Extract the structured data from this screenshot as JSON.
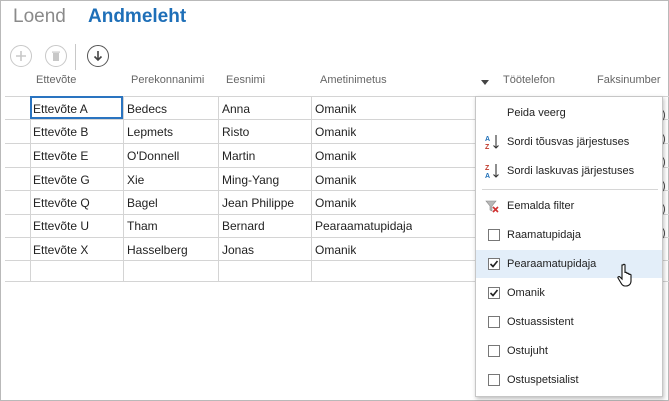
{
  "tabs": {
    "list": "Loend",
    "datasheet": "Andmeleht"
  },
  "toolbar": {
    "add_icon": "plus-circle-icon",
    "delete_icon": "trash-circle-icon",
    "download_icon": "down-arrow-circle-icon"
  },
  "columns": [
    "Ettevõte",
    "Perekonnanimi",
    "Eesnimi",
    "Ametinimetus",
    "Töötelefon",
    "Faksinumber"
  ],
  "rows": [
    [
      "Ettevõte A",
      "Bedecs",
      "Anna",
      "Omanik"
    ],
    [
      "Ettevõte B",
      "Lepmets",
      "Risto",
      "Omanik"
    ],
    [
      "Ettevõte E",
      "O'Donnell",
      "Martin",
      "Omanik"
    ],
    [
      "Ettevõte G",
      "Xie",
      "Ming-Yang",
      "Omanik"
    ],
    [
      "Ettevõte Q",
      "Bagel",
      "Jean Philippe",
      "Omanik"
    ],
    [
      "Ettevõte U",
      "Tham",
      "Bernard",
      "Pearaamatupidaja"
    ],
    [
      "Ettevõte X",
      "Hasselberg",
      "Jonas",
      "Omanik"
    ]
  ],
  "menu": {
    "hide_column": "Peida veerg",
    "sort_asc": "Sordi tõusvas järjestuses",
    "sort_desc": "Sordi laskuvas järjestuses",
    "remove_filter": "Eemalda filter",
    "filters": [
      {
        "label": "Raamatupidaja",
        "checked": false
      },
      {
        "label": "Pearaamatupidaja",
        "checked": true
      },
      {
        "label": "Omanik",
        "checked": true
      },
      {
        "label": "Ostuassistent",
        "checked": false
      },
      {
        "label": "Ostujuht",
        "checked": false
      },
      {
        "label": "Ostuspetsialist",
        "checked": false
      }
    ]
  },
  "colors": {
    "accent": "#1e6fb8",
    "selection": "#2a74c0",
    "hover": "#e3eef9"
  }
}
